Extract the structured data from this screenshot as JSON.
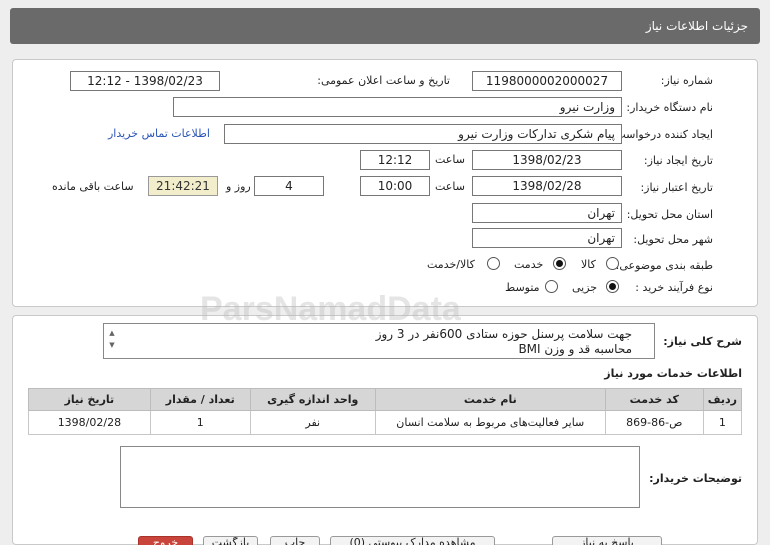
{
  "header": {
    "title": "جزئیات اطلاعات نیاز"
  },
  "form": {
    "need_number_label": "شماره نیاز:",
    "need_number": "1198000002000027",
    "announce_label": "تاریخ و ساعت اعلان عمومی:",
    "announce_value": "1398/02/23 - 12:12",
    "buyer_org_label": "نام دستگاه خریدار:",
    "buyer_org": "وزارت نیرو",
    "requester_label": "ایجاد کننده درخواست:",
    "requester": "پیام شکری تدارکات وزارت نیرو",
    "contact_link": "اطلاعات تماس خریدار",
    "created_label": "تاریخ ایجاد نیاز:",
    "created_date": "1398/02/23",
    "time_label": "ساعت",
    "created_time": "12:12",
    "validity_label": "تاریخ اعتبار نیاز:",
    "validity_date": "1398/02/28",
    "validity_time": "10:00",
    "days_value": "4",
    "days_label": "روز و",
    "remaining_time": "21:42:21",
    "remaining_label": "ساعت باقی مانده",
    "province_label": "استان محل تحویل:",
    "province": "تهران",
    "city_label": "شهر محل تحویل:",
    "city": "تهران",
    "category_label": "طبقه بندی موضوعی:",
    "category_options": [
      "کالا",
      "خدمت",
      "کالا/خدمت"
    ],
    "category_selected": "خدمت",
    "process_label": "نوع فرآیند خرید :",
    "process_options": [
      "جزیی",
      "متوسط"
    ],
    "process_selected": "جزیی"
  },
  "description": {
    "label": "شرح کلی نیاز:",
    "line1": "جهت سلامت پرسنل حوزه ستادی 600نفر در 3 روز",
    "line2": "محاسبه قد و وزن BMI"
  },
  "services": {
    "title": "اطلاعات خدمات مورد نیاز",
    "columns": [
      "ردیف",
      "کد خدمت",
      "نام خدمت",
      "واحد اندازه گیری",
      "تعداد / مقدار",
      "تاریخ نیاز"
    ],
    "rows": [
      [
        "1",
        "ص-86-869",
        "سایر فعالیت‌های مربوط به سلامت انسان",
        "نفر",
        "1",
        "1398/02/28"
      ]
    ]
  },
  "buyer_notes": {
    "label": "توضیحات خریدار:"
  },
  "buttons": {
    "reply": "پاسخ به نیاز",
    "docs": "مشاهده مدارک پیوستی (0)",
    "print": "چاپ",
    "back": "بازگشت",
    "exit": "خروج"
  },
  "watermark": {
    "brand": "ParsNamadData"
  }
}
